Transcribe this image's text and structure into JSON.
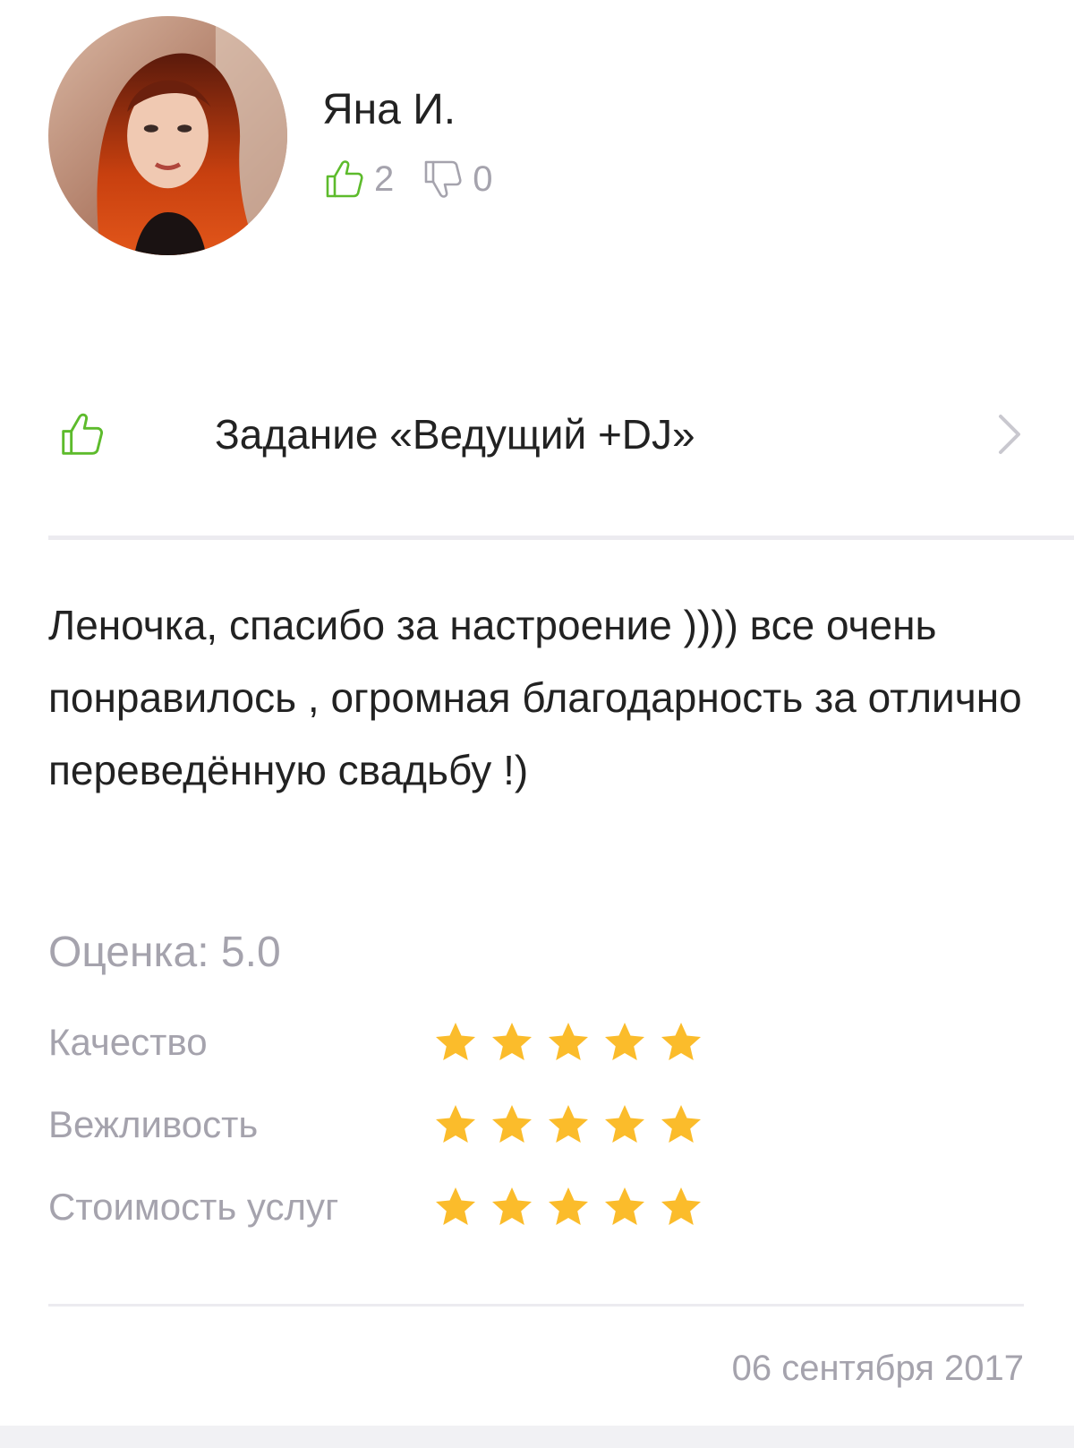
{
  "author": {
    "name": "Яна И.",
    "likes": "2",
    "dislikes": "0"
  },
  "task": {
    "title": "Задание «Ведущий +DJ»",
    "icon": "thumbs-up-icon"
  },
  "review": {
    "text": "Леночка, спасибо за настроение )))) все очень понравилось , огромная благодарность за отлично переведённую свадьбу !)"
  },
  "rating": {
    "total_label": "Оценка: 5.0",
    "criteria": [
      {
        "label": "Качество",
        "stars": 5
      },
      {
        "label": "Вежливость",
        "stars": 5
      },
      {
        "label": "Стоимость услуг",
        "stars": 5
      }
    ]
  },
  "date": "06 сентября 2017",
  "colors": {
    "accent_green": "#5dbb2c",
    "star_yellow": "#fbbc2b",
    "muted_text": "#a5a3ad",
    "primary_text": "#222222"
  }
}
